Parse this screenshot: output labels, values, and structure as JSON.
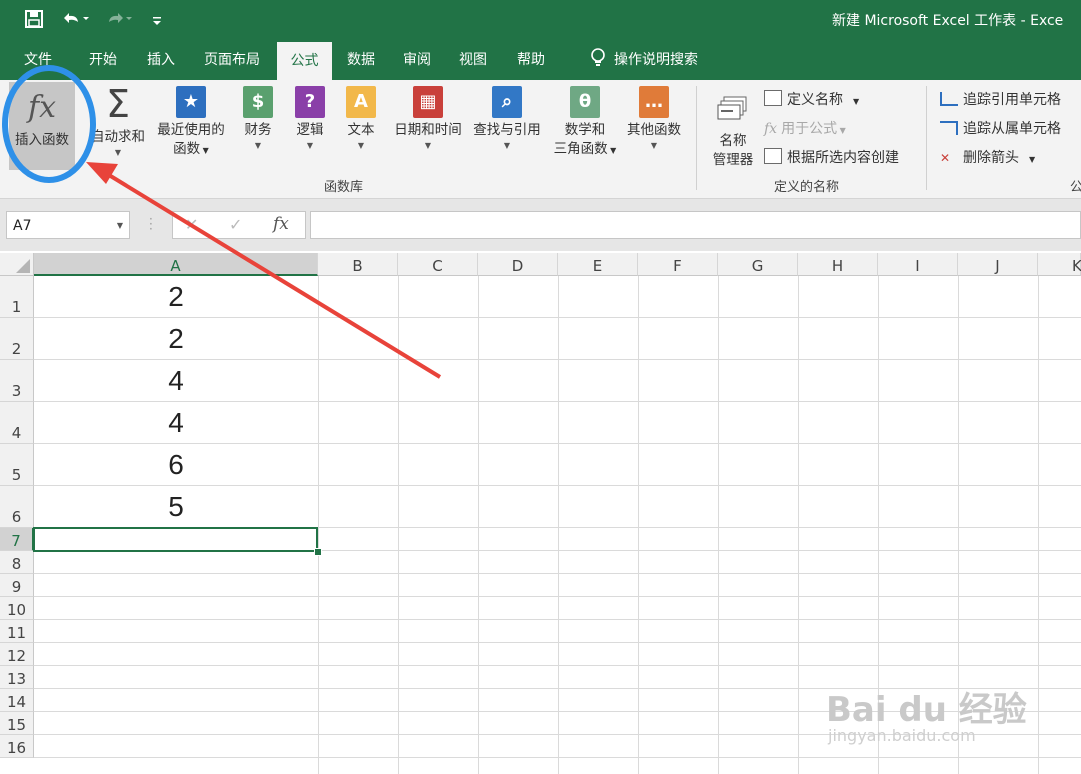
{
  "window": {
    "title": "新建 Microsoft Excel 工作表 - Exce"
  },
  "quick_access": {
    "save_icon": "save-icon",
    "undo_icon": "undo-icon",
    "redo_icon": "redo-icon",
    "customize_icon": "customize-icon"
  },
  "tabs": [
    {
      "label": "文件"
    },
    {
      "label": "开始"
    },
    {
      "label": "插入"
    },
    {
      "label": "页面布局"
    },
    {
      "label": "公式"
    },
    {
      "label": "数据"
    },
    {
      "label": "审阅"
    },
    {
      "label": "视图"
    },
    {
      "label": "帮助"
    },
    {
      "label": "操作说明搜索"
    }
  ],
  "active_tab": "公式",
  "ribbon": {
    "insert_function": "插入函数",
    "autosum": "自动求和",
    "recent_l1": "最近使用的",
    "recent_l2": "函数",
    "finance": "财务",
    "logic": "逻辑",
    "text": "文本",
    "datetime": "日期和时间",
    "lookup": "查找与引用",
    "math_l1": "数学和",
    "math_l2": "三角函数",
    "other": "其他函数",
    "group_library": "函数库",
    "name_mgr_l1": "名称",
    "name_mgr_l2": "管理器",
    "define_name": "定义名称",
    "use_in_formula": "用于公式",
    "create_from_selection": "根据所选内容创建",
    "group_defined": "定义的名称",
    "trace_precedents": "追踪引用单元格",
    "trace_dependents": "追踪从属单元格",
    "remove_arrows": "删除箭头",
    "group_audit_partial": "公"
  },
  "formula_bar": {
    "name_box": "A7",
    "formula": ""
  },
  "sheet": {
    "columns": [
      "A",
      "B",
      "C",
      "D",
      "E",
      "F",
      "G",
      "H",
      "I",
      "J",
      "K"
    ],
    "rows": [
      "1",
      "2",
      "3",
      "4",
      "5",
      "6",
      "7",
      "8",
      "9",
      "10",
      "11",
      "12",
      "13",
      "14",
      "15",
      "16"
    ],
    "selected_cell": "A7",
    "colA_values": [
      "2",
      "2",
      "4",
      "4",
      "6",
      "5"
    ]
  },
  "watermark": {
    "text": "Bai du 经验",
    "url": "jingyan.baidu.com"
  },
  "colors": {
    "excel_green": "#217346",
    "annotation_blue": "#2e90e8",
    "annotation_red": "#e8433a"
  }
}
